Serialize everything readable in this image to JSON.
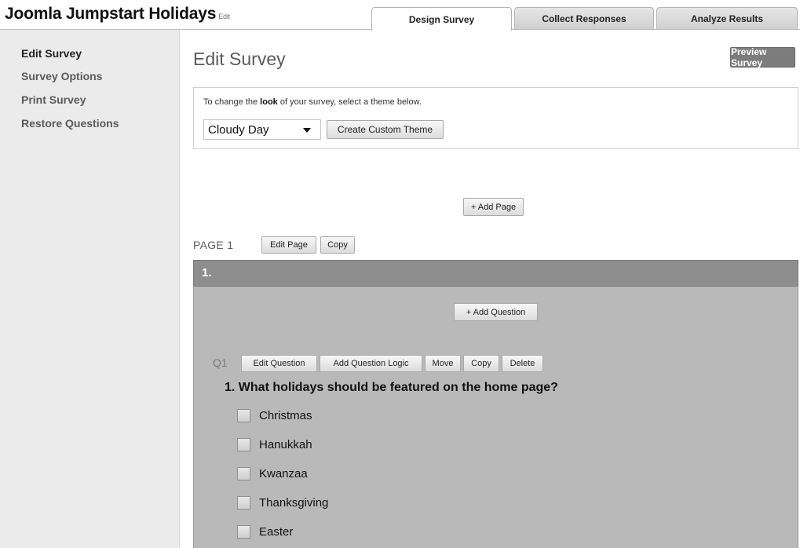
{
  "app": {
    "title": "Joomla Jumpstart Holidays",
    "edit_link": "Edit"
  },
  "tabs": [
    "Design Survey",
    "Collect Responses",
    "Analyze Results"
  ],
  "sidebar": {
    "items": [
      {
        "label": "Edit Survey"
      },
      {
        "label": "Survey Options"
      },
      {
        "label": "Print Survey"
      },
      {
        "label": "Restore Questions"
      }
    ]
  },
  "main": {
    "heading": "Edit Survey",
    "preview_button": "Preview Survey",
    "theme": {
      "text_before": "To change the ",
      "text_bold": "look",
      "text_after": " of your survey, select a theme below.",
      "selected": "Cloudy Day",
      "custom_button": "Create Custom Theme"
    },
    "add_page_button": "+ Add Page",
    "page": {
      "label": "PAGE 1",
      "edit_button": "Edit Page",
      "copy_button": "Copy",
      "number": "1.",
      "add_question_button": "+ Add Question"
    },
    "question": {
      "label": "Q1",
      "actions": [
        "Edit Question",
        "Add Question Logic",
        "Move",
        "Copy",
        "Delete"
      ],
      "text": "1. What holidays should be featured on the home page?",
      "options": [
        "Christmas",
        "Hanukkah",
        "Kwanzaa",
        "Thanksgiving",
        "Easter"
      ]
    }
  }
}
